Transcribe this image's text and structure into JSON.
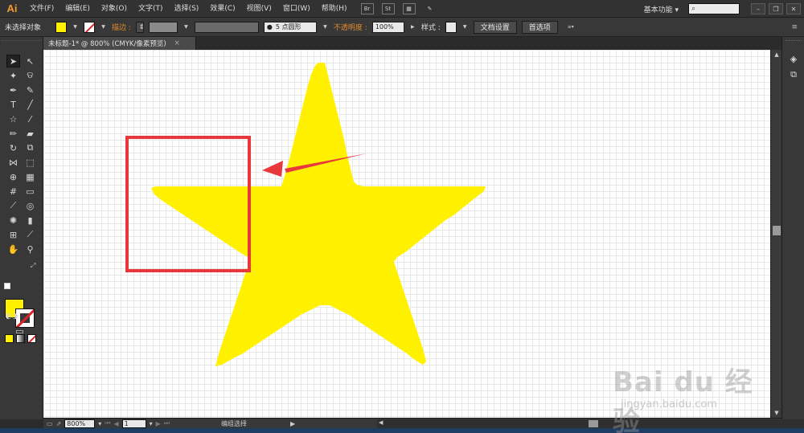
{
  "app": {
    "logo": "Ai"
  },
  "menu": [
    "文件(F)",
    "编辑(E)",
    "对象(O)",
    "文字(T)",
    "选择(S)",
    "效果(C)",
    "视图(V)",
    "窗口(W)",
    "帮助(H)"
  ],
  "menubar_icons": {
    "br": "Br",
    "st": "St"
  },
  "workspace": "基本功能",
  "control": {
    "no_selection": "未选择对象",
    "fill_color": "#fff100",
    "stroke_label": "描边 :",
    "brush_label": "5 点圆形",
    "opacity_label": "不透明度 :",
    "opacity_value": "100%",
    "style_label": "样式 :",
    "doc_setup": "文档设置",
    "preferences": "首选项"
  },
  "tab": {
    "title": "未标题-1* @ 800% (CMYK/像素预览)",
    "close": "×"
  },
  "status": {
    "zoom": "800%",
    "page": "1",
    "info": "编组选择"
  },
  "canvas": {
    "star_color": "#fff100",
    "highlight_color": "#e8383d"
  },
  "watermark": {
    "text": "Bai du 经验",
    "url": "jingyan.baidu.com"
  }
}
